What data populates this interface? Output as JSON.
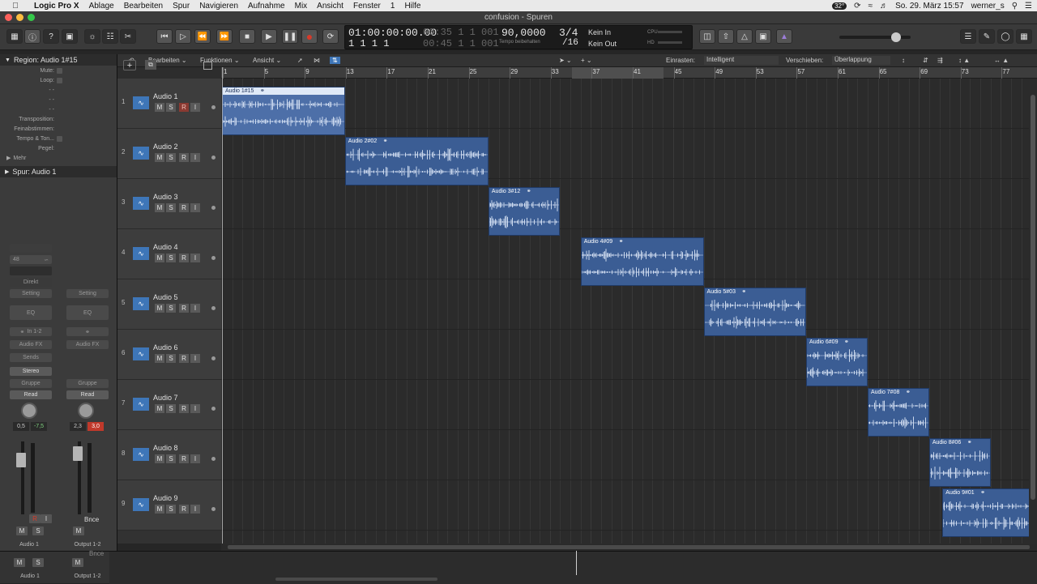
{
  "menubar": {
    "app": "Logic Pro X",
    "items": [
      "Ablage",
      "Bearbeiten",
      "Spur",
      "Navigieren",
      "Aufnahme",
      "Mix",
      "Ansicht",
      "Fenster",
      "1",
      "Hilfe"
    ],
    "temp": "32°",
    "datetime": "So. 29. März  15:57",
    "user": "werner_s"
  },
  "window": {
    "title": "confusion - Spuren"
  },
  "lcd": {
    "time": "01:00:00:00.00",
    "time_dim": "00:35  1  1  001",
    "bars": "1  1  1     1",
    "bars_dim": "00:45  1  1  001",
    "tempo": "90,0000",
    "tempo_label": "Tempo beibehalten",
    "sig_top": "3/4",
    "sig_bottom": "/16",
    "in": "Kein In",
    "out": "Kein Out",
    "cpu": "CPU",
    "hd": "HD"
  },
  "inspector": {
    "region_label": "Region: Audio 1#15",
    "params": [
      "Mute:",
      "Loop:",
      "-  -",
      "-  -",
      "-  -",
      "Transposition:",
      "Feinabstimmen:",
      "Tempo & Ton...",
      "Pegel:"
    ],
    "more": "Mehr",
    "track_label": "Spur:  Audio 1",
    "strip1": {
      "setting": "Setting",
      "eq": "EQ",
      "input": "In 1-2",
      "fx": "Audio FX",
      "sends": "Sends",
      "stereo": "Stereo",
      "group": "Gruppe",
      "read": "Read",
      "val1": "0,5",
      "val2": "-7,5",
      "name": "Audio 1",
      "r": "R",
      "i": "I",
      "m": "M",
      "s": "S"
    },
    "strip2": {
      "setting": "Setting",
      "eq": "EQ",
      "fx": "Audio FX",
      "group": "Gruppe",
      "read": "Read",
      "val1": "2,3",
      "val2": "3,0",
      "bnce": "Bnce",
      "name": "Output 1-2",
      "m": "M"
    },
    "direct": "Direkt",
    "num48": "48"
  },
  "trackbar": {
    "edit": "Bearbeiten",
    "functions": "Funktionen",
    "view": "Ansicht",
    "snap_label": "Einrasten:",
    "snap_value": "Intelligent",
    "drag_label": "Verschieben:",
    "drag_value": "Überlappung"
  },
  "ruler": [
    "1",
    "5",
    "9",
    "13",
    "17",
    "21",
    "25",
    "29",
    "33",
    "37",
    "41",
    "45",
    "49",
    "53",
    "57",
    "61",
    "65",
    "69",
    "73",
    "77"
  ],
  "tracks": [
    {
      "num": "1",
      "name": "Audio 1"
    },
    {
      "num": "2",
      "name": "Audio 2"
    },
    {
      "num": "3",
      "name": "Audio 3"
    },
    {
      "num": "4",
      "name": "Audio 4"
    },
    {
      "num": "5",
      "name": "Audio 5"
    },
    {
      "num": "6",
      "name": "Audio 6"
    },
    {
      "num": "7",
      "name": "Audio 7"
    },
    {
      "num": "8",
      "name": "Audio 8"
    },
    {
      "num": "9",
      "name": "Audio 9"
    }
  ],
  "track_buttons": {
    "m": "M",
    "s": "S",
    "r": "R",
    "i": "I"
  },
  "regions": [
    {
      "name": "Audio 1#15",
      "selected": true
    },
    {
      "name": "Audio 2#02"
    },
    {
      "name": "Audio 3#12"
    },
    {
      "name": "Audio 4#09"
    },
    {
      "name": "Audio 5#03"
    },
    {
      "name": "Audio 6#09"
    },
    {
      "name": "Audio 7#08"
    },
    {
      "name": "Audio 8#06"
    },
    {
      "name": "Audio 9#01"
    }
  ],
  "bottom": {
    "m": "M",
    "s": "S",
    "m2": "M",
    "name1": "Audio 1",
    "name2": "Output 1-2",
    "bnce": "Bnce"
  },
  "colors": {
    "region": "#3b5d94",
    "region_selected": "#4d6fa8",
    "record": "#d63a2a",
    "accent": "#3e76b8"
  }
}
